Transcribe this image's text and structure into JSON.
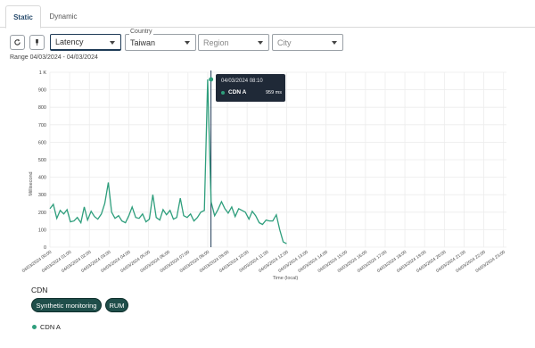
{
  "tabs": [
    {
      "label": "Static",
      "active": true
    },
    {
      "label": "Dynamic",
      "active": false
    }
  ],
  "toolbar": {
    "refresh_icon": "refresh-icon",
    "pin_icon": "pin-icon"
  },
  "filters": {
    "metric": "Latency",
    "country_label": "Country",
    "country": "Taiwan",
    "region_placeholder": "Region",
    "city_placeholder": "City"
  },
  "range_text": "Range 04/03/2024 - 04/03/2024",
  "tooltip": {
    "date": "04/03/2024 08:10",
    "series": "CDN A",
    "value": "959 ms"
  },
  "legend": {
    "title": "CDN",
    "chips": [
      "Synthetic monitoring",
      "RUM"
    ],
    "series": "CDN A"
  },
  "colors": {
    "series": "#2e9e7c",
    "chip_bg": "#1f4e4a",
    "tooltip_bg": "#1f2937",
    "active_tab_text": "#2a4d6e"
  },
  "chart_data": {
    "type": "line",
    "ylabel": "Millisecond",
    "xlabel": "Time (local)",
    "ylim": [
      0,
      1000
    ],
    "y_ticks": [
      "0",
      "100",
      "200",
      "300",
      "400",
      "500",
      "600",
      "700",
      "800",
      "900",
      "1 K"
    ],
    "x_ticks": [
      "04/03/2024 00:00",
      "04/03/2024 01:00",
      "04/03/2024 02:00",
      "04/03/2024 03:00",
      "04/03/2024 04:00",
      "04/03/2024 05:00",
      "04/03/2024 06:00",
      "04/03/2024 07:00",
      "04/03/2024 08:00",
      "04/03/2024 09:00",
      "04/03/2024 10:00",
      "04/03/2024 11:00",
      "04/03/2024 12:00",
      "04/03/2024 13:00",
      "04/03/2024 14:00",
      "04/03/2024 15:00",
      "04/03/2024 16:00",
      "04/03/2024 17:00",
      "04/03/2024 18:00",
      "04/03/2024 19:00",
      "04/03/2024 20:00",
      "04/03/2024 21:00",
      "04/03/2024 22:00",
      "04/03/2024 23:00"
    ],
    "grid": true,
    "series": [
      {
        "name": "CDN A",
        "x_hours": [
          0.0,
          0.17,
          0.35,
          0.52,
          0.7,
          0.87,
          1.04,
          1.22,
          1.39,
          1.57,
          1.74,
          1.91,
          2.09,
          2.26,
          2.43,
          2.61,
          2.78,
          2.96,
          3.13,
          3.3,
          3.48,
          3.65,
          3.83,
          4.0,
          4.17,
          4.35,
          4.52,
          4.7,
          4.87,
          5.04,
          5.22,
          5.39,
          5.57,
          5.74,
          5.91,
          6.09,
          6.26,
          6.43,
          6.61,
          6.78,
          6.96,
          7.13,
          7.3,
          7.48,
          7.65,
          7.83,
          8.0,
          8.17,
          8.35,
          8.52,
          8.7,
          8.87,
          9.04,
          9.22,
          9.39,
          9.57,
          9.74,
          9.91,
          10.09,
          10.26,
          10.43,
          10.61,
          10.78,
          10.96,
          11.13,
          11.3,
          11.48,
          11.65,
          11.83,
          12.0
        ],
        "values": [
          220,
          245,
          165,
          210,
          190,
          215,
          145,
          150,
          170,
          140,
          230,
          155,
          205,
          175,
          160,
          190,
          250,
          370,
          200,
          165,
          180,
          150,
          140,
          180,
          230,
          170,
          165,
          190,
          145,
          160,
          300,
          170,
          155,
          215,
          185,
          210,
          160,
          170,
          280,
          180,
          170,
          190,
          150,
          170,
          200,
          210,
          959,
          260,
          180,
          215,
          260,
          220,
          195,
          230,
          175,
          220,
          210,
          200,
          160,
          205,
          180,
          140,
          130,
          155,
          150,
          150,
          185,
          100,
          30,
          20
        ]
      }
    ],
    "marker_time": "04/03/2024 08:10"
  }
}
